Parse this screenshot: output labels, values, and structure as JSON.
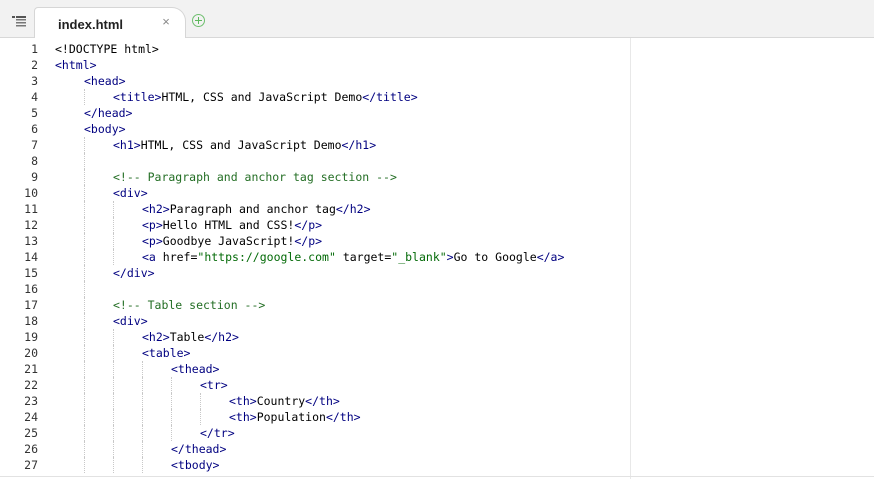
{
  "tab": {
    "filename": "index.html",
    "close_glyph": "×"
  },
  "icons": {
    "menu": "hamburger-list-icon",
    "add": "plus-circle-icon",
    "close": "close-icon"
  },
  "colors": {
    "tag": "#000080",
    "string": "#036a07",
    "comment": "#236e24",
    "add_icon": "#5cb85c"
  },
  "code_lines": [
    {
      "n": "1",
      "indent": 0,
      "tokens": [
        [
          "doc",
          "<!DOCTYPE html>"
        ]
      ]
    },
    {
      "n": "2",
      "indent": 0,
      "tokens": [
        [
          "tag",
          "<html>"
        ]
      ]
    },
    {
      "n": "3",
      "indent": 1,
      "tokens": [
        [
          "tag",
          "<head>"
        ]
      ]
    },
    {
      "n": "4",
      "indent": 2,
      "tokens": [
        [
          "tag",
          "<title>"
        ],
        [
          "txt",
          "HTML, CSS and JavaScript Demo"
        ],
        [
          "tag",
          "</title>"
        ]
      ]
    },
    {
      "n": "5",
      "indent": 1,
      "tokens": [
        [
          "tag",
          "</head>"
        ]
      ]
    },
    {
      "n": "6",
      "indent": 1,
      "tokens": [
        [
          "tag",
          "<body>"
        ]
      ]
    },
    {
      "n": "7",
      "indent": 2,
      "tokens": [
        [
          "tag",
          "<h1>"
        ],
        [
          "txt",
          "HTML, CSS and JavaScript Demo"
        ],
        [
          "tag",
          "</h1>"
        ]
      ]
    },
    {
      "n": "8",
      "indent": 0,
      "tokens": []
    },
    {
      "n": "9",
      "indent": 2,
      "tokens": [
        [
          "cmt",
          "<!-- Paragraph and anchor tag section -->"
        ]
      ]
    },
    {
      "n": "10",
      "indent": 2,
      "tokens": [
        [
          "tag",
          "<div>"
        ]
      ]
    },
    {
      "n": "11",
      "indent": 3,
      "tokens": [
        [
          "tag",
          "<h2>"
        ],
        [
          "txt",
          "Paragraph and anchor tag"
        ],
        [
          "tag",
          "</h2>"
        ]
      ]
    },
    {
      "n": "12",
      "indent": 3,
      "tokens": [
        [
          "tag",
          "<p>"
        ],
        [
          "txt",
          "Hello HTML and CSS!"
        ],
        [
          "tag",
          "</p>"
        ]
      ]
    },
    {
      "n": "13",
      "indent": 3,
      "tokens": [
        [
          "tag",
          "<p>"
        ],
        [
          "txt",
          "Goodbye JavaScript!"
        ],
        [
          "tag",
          "</p>"
        ]
      ]
    },
    {
      "n": "14",
      "indent": 3,
      "tokens": [
        [
          "tag",
          "<a "
        ],
        [
          "attr",
          "href="
        ],
        [
          "str",
          "\"https://google.com\""
        ],
        [
          "attr",
          " target="
        ],
        [
          "str",
          "\"_blank\""
        ],
        [
          "tag",
          ">"
        ],
        [
          "txt",
          "Go to Google"
        ],
        [
          "tag",
          "</a>"
        ]
      ]
    },
    {
      "n": "15",
      "indent": 2,
      "tokens": [
        [
          "tag",
          "</div>"
        ]
      ]
    },
    {
      "n": "16",
      "indent": 0,
      "tokens": []
    },
    {
      "n": "17",
      "indent": 2,
      "tokens": [
        [
          "cmt",
          "<!-- Table section -->"
        ]
      ]
    },
    {
      "n": "18",
      "indent": 2,
      "tokens": [
        [
          "tag",
          "<div>"
        ]
      ]
    },
    {
      "n": "19",
      "indent": 3,
      "tokens": [
        [
          "tag",
          "<h2>"
        ],
        [
          "txt",
          "Table"
        ],
        [
          "tag",
          "</h2>"
        ]
      ]
    },
    {
      "n": "20",
      "indent": 3,
      "tokens": [
        [
          "tag",
          "<table>"
        ]
      ]
    },
    {
      "n": "21",
      "indent": 4,
      "tokens": [
        [
          "tag",
          "<thead>"
        ]
      ]
    },
    {
      "n": "22",
      "indent": 5,
      "tokens": [
        [
          "tag",
          "<tr>"
        ]
      ]
    },
    {
      "n": "23",
      "indent": 6,
      "tokens": [
        [
          "tag",
          "<th>"
        ],
        [
          "txt",
          "Country"
        ],
        [
          "tag",
          "</th>"
        ]
      ]
    },
    {
      "n": "24",
      "indent": 6,
      "tokens": [
        [
          "tag",
          "<th>"
        ],
        [
          "txt",
          "Population"
        ],
        [
          "tag",
          "</th>"
        ]
      ]
    },
    {
      "n": "25",
      "indent": 5,
      "tokens": [
        [
          "tag",
          "</tr>"
        ]
      ]
    },
    {
      "n": "26",
      "indent": 4,
      "tokens": [
        [
          "tag",
          "</thead>"
        ]
      ]
    },
    {
      "n": "27",
      "indent": 4,
      "tokens": [
        [
          "tag",
          "<tbody>"
        ]
      ]
    }
  ]
}
